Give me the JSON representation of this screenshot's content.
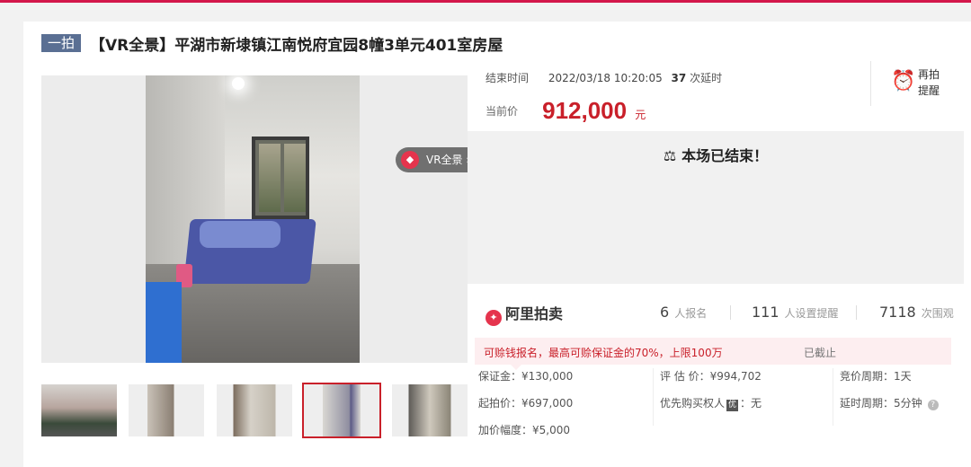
{
  "header": {
    "badge": "一拍",
    "title": "【VR全景】平湖市新埭镇江南悦府宜园8幢3单元401室房屋"
  },
  "gallery": {
    "vr_label": "VR全景",
    "vr_icon": "vr-icon",
    "zoom_icon": "magnifier-icon",
    "thumbnail_count": 5,
    "active_thumbnail": 4
  },
  "auction": {
    "end_label": "结束时间",
    "end_time": "2022/03/18 10:20:05",
    "delay_count": "37",
    "delay_suffix": "次延时",
    "price_label": "当前价",
    "price": "912,000",
    "price_unit": "元",
    "remind_line1": "再拍",
    "remind_line2": "提醒",
    "ended_message": "本场已结束！"
  },
  "stats": {
    "logo": "阿里拍卖",
    "signups": "6",
    "signups_label": "人报名",
    "reminders": "111",
    "reminders_label": "人设置提醒",
    "views": "7118",
    "views_label": "次围观"
  },
  "notice": {
    "text": "可赊钱报名，最高可赊保证金的70%，上限100万",
    "status": "已截止"
  },
  "details": {
    "deposit": "保证金：¥130,000",
    "appraisal": "评 估 价：¥994,702",
    "bid_cycle_label": "竞价周期",
    "bid_cycle": "：1天",
    "start_price": "起拍价：¥697,000",
    "priority_label": "优先购买权人",
    "priority_icon": "优",
    "priority_value": "：无",
    "delay_cycle_label": "延时周期",
    "delay_cycle": "：5分钟",
    "increment": "加价幅度：¥5,000"
  },
  "colors": {
    "accent": "#c9202a",
    "brand": "#d3174b",
    "badge": "#5a6f93"
  }
}
